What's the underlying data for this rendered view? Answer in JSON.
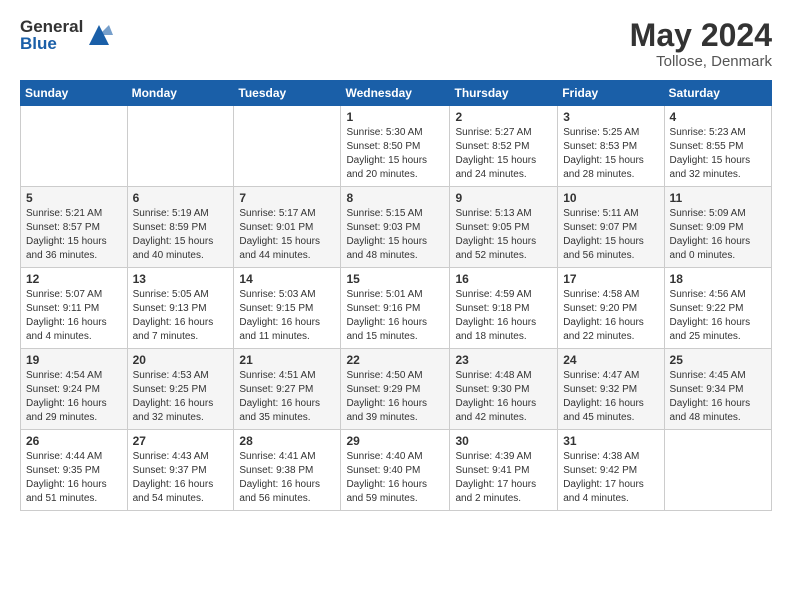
{
  "logo": {
    "general": "General",
    "blue": "Blue"
  },
  "header": {
    "title": "May 2024",
    "subtitle": "Tollose, Denmark"
  },
  "weekdays": [
    "Sunday",
    "Monday",
    "Tuesday",
    "Wednesday",
    "Thursday",
    "Friday",
    "Saturday"
  ],
  "weeks": [
    [
      {
        "day": "",
        "info": ""
      },
      {
        "day": "",
        "info": ""
      },
      {
        "day": "",
        "info": ""
      },
      {
        "day": "1",
        "info": "Sunrise: 5:30 AM\nSunset: 8:50 PM\nDaylight: 15 hours\nand 20 minutes."
      },
      {
        "day": "2",
        "info": "Sunrise: 5:27 AM\nSunset: 8:52 PM\nDaylight: 15 hours\nand 24 minutes."
      },
      {
        "day": "3",
        "info": "Sunrise: 5:25 AM\nSunset: 8:53 PM\nDaylight: 15 hours\nand 28 minutes."
      },
      {
        "day": "4",
        "info": "Sunrise: 5:23 AM\nSunset: 8:55 PM\nDaylight: 15 hours\nand 32 minutes."
      }
    ],
    [
      {
        "day": "5",
        "info": "Sunrise: 5:21 AM\nSunset: 8:57 PM\nDaylight: 15 hours\nand 36 minutes."
      },
      {
        "day": "6",
        "info": "Sunrise: 5:19 AM\nSunset: 8:59 PM\nDaylight: 15 hours\nand 40 minutes."
      },
      {
        "day": "7",
        "info": "Sunrise: 5:17 AM\nSunset: 9:01 PM\nDaylight: 15 hours\nand 44 minutes."
      },
      {
        "day": "8",
        "info": "Sunrise: 5:15 AM\nSunset: 9:03 PM\nDaylight: 15 hours\nand 48 minutes."
      },
      {
        "day": "9",
        "info": "Sunrise: 5:13 AM\nSunset: 9:05 PM\nDaylight: 15 hours\nand 52 minutes."
      },
      {
        "day": "10",
        "info": "Sunrise: 5:11 AM\nSunset: 9:07 PM\nDaylight: 15 hours\nand 56 minutes."
      },
      {
        "day": "11",
        "info": "Sunrise: 5:09 AM\nSunset: 9:09 PM\nDaylight: 16 hours\nand 0 minutes."
      }
    ],
    [
      {
        "day": "12",
        "info": "Sunrise: 5:07 AM\nSunset: 9:11 PM\nDaylight: 16 hours\nand 4 minutes."
      },
      {
        "day": "13",
        "info": "Sunrise: 5:05 AM\nSunset: 9:13 PM\nDaylight: 16 hours\nand 7 minutes."
      },
      {
        "day": "14",
        "info": "Sunrise: 5:03 AM\nSunset: 9:15 PM\nDaylight: 16 hours\nand 11 minutes."
      },
      {
        "day": "15",
        "info": "Sunrise: 5:01 AM\nSunset: 9:16 PM\nDaylight: 16 hours\nand 15 minutes."
      },
      {
        "day": "16",
        "info": "Sunrise: 4:59 AM\nSunset: 9:18 PM\nDaylight: 16 hours\nand 18 minutes."
      },
      {
        "day": "17",
        "info": "Sunrise: 4:58 AM\nSunset: 9:20 PM\nDaylight: 16 hours\nand 22 minutes."
      },
      {
        "day": "18",
        "info": "Sunrise: 4:56 AM\nSunset: 9:22 PM\nDaylight: 16 hours\nand 25 minutes."
      }
    ],
    [
      {
        "day": "19",
        "info": "Sunrise: 4:54 AM\nSunset: 9:24 PM\nDaylight: 16 hours\nand 29 minutes."
      },
      {
        "day": "20",
        "info": "Sunrise: 4:53 AM\nSunset: 9:25 PM\nDaylight: 16 hours\nand 32 minutes."
      },
      {
        "day": "21",
        "info": "Sunrise: 4:51 AM\nSunset: 9:27 PM\nDaylight: 16 hours\nand 35 minutes."
      },
      {
        "day": "22",
        "info": "Sunrise: 4:50 AM\nSunset: 9:29 PM\nDaylight: 16 hours\nand 39 minutes."
      },
      {
        "day": "23",
        "info": "Sunrise: 4:48 AM\nSunset: 9:30 PM\nDaylight: 16 hours\nand 42 minutes."
      },
      {
        "day": "24",
        "info": "Sunrise: 4:47 AM\nSunset: 9:32 PM\nDaylight: 16 hours\nand 45 minutes."
      },
      {
        "day": "25",
        "info": "Sunrise: 4:45 AM\nSunset: 9:34 PM\nDaylight: 16 hours\nand 48 minutes."
      }
    ],
    [
      {
        "day": "26",
        "info": "Sunrise: 4:44 AM\nSunset: 9:35 PM\nDaylight: 16 hours\nand 51 minutes."
      },
      {
        "day": "27",
        "info": "Sunrise: 4:43 AM\nSunset: 9:37 PM\nDaylight: 16 hours\nand 54 minutes."
      },
      {
        "day": "28",
        "info": "Sunrise: 4:41 AM\nSunset: 9:38 PM\nDaylight: 16 hours\nand 56 minutes."
      },
      {
        "day": "29",
        "info": "Sunrise: 4:40 AM\nSunset: 9:40 PM\nDaylight: 16 hours\nand 59 minutes."
      },
      {
        "day": "30",
        "info": "Sunrise: 4:39 AM\nSunset: 9:41 PM\nDaylight: 17 hours\nand 2 minutes."
      },
      {
        "day": "31",
        "info": "Sunrise: 4:38 AM\nSunset: 9:42 PM\nDaylight: 17 hours\nand 4 minutes."
      },
      {
        "day": "",
        "info": ""
      }
    ]
  ]
}
